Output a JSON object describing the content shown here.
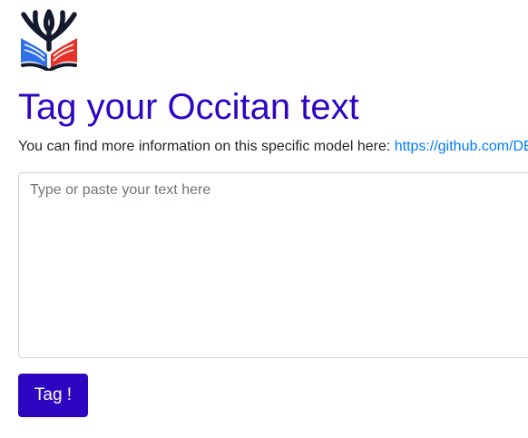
{
  "colors": {
    "primary": "#2e06c2",
    "link": "#007bff",
    "logo_dark": "#141a2e",
    "logo_blue": "#2f6fe8",
    "logo_red": "#e5332a"
  },
  "logo": {
    "icon": "tree-book-logo-icon"
  },
  "header": {
    "title": "Tag your Occitan text"
  },
  "info": {
    "text": "You can find more information on this specific model here: ",
    "link_text": "https://github.com/DE"
  },
  "input": {
    "value": "",
    "placeholder": "Type or paste your text here"
  },
  "actions": {
    "tag_label": "Tag !"
  },
  "results": {
    "heading": ""
  }
}
